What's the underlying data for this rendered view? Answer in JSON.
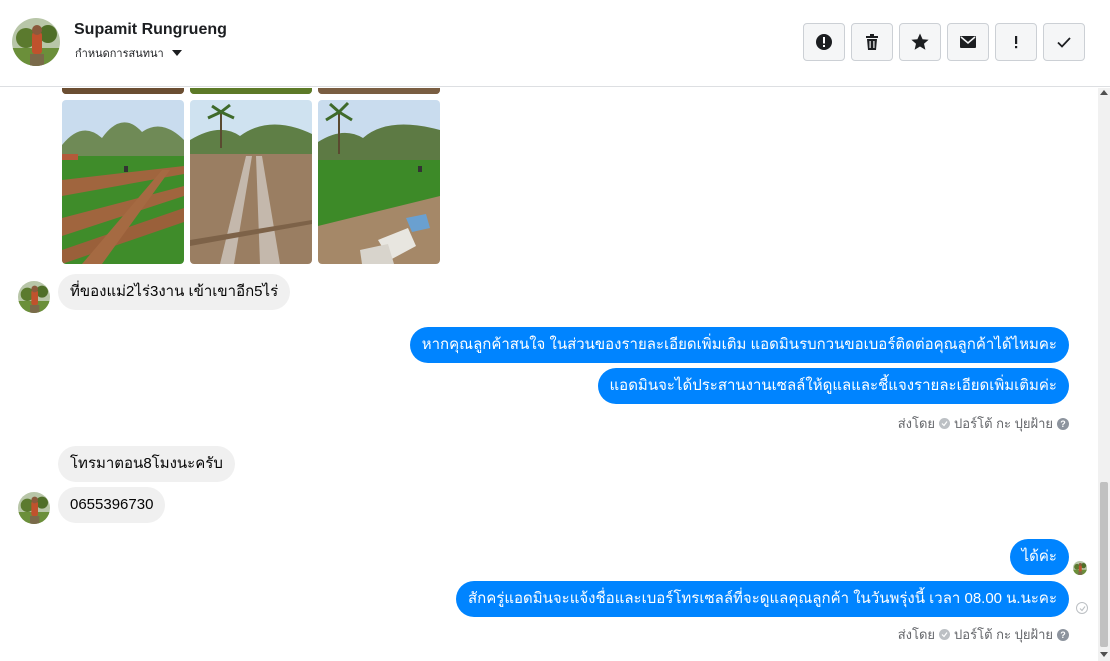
{
  "header": {
    "contact_name": "Supamit Rungrueng",
    "subtitle": "กำหนดการสนทนา",
    "toolbar": [
      {
        "icon": "alert-circle-icon",
        "name": "report-button"
      },
      {
        "icon": "trash-icon",
        "name": "delete-button"
      },
      {
        "icon": "star-icon",
        "name": "star-button"
      },
      {
        "icon": "envelope-icon",
        "name": "mark-unread-button"
      },
      {
        "icon": "exclamation-icon",
        "name": "spam-button"
      },
      {
        "icon": "checkmark-icon",
        "name": "done-button"
      }
    ]
  },
  "messages": {
    "in_1": "ที่ของแม่2ไร่3งาน เข้าเขาอีก5ไร่",
    "out_1": "หากคุณลูกค้าสนใจ ในส่วนของรายละเอียดเพิ่มเติม แอดมินรบกวนขอเบอร์ติดต่อคุณลูกค้าได้ไหมคะ",
    "out_2": "แอดมินจะได้ประสานงานเซลล์ให้ดูแลและชี้แจงรายละเอียดเพิ่มเติมค่ะ",
    "sent_by_1": "ส่งโดย",
    "sender_1": "ปอร์โต้ กะ ปุยฝ้าย",
    "in_2": "โทรมาตอน8โมงนะครับ",
    "in_3": "0655396730",
    "out_3": "ได้ค่ะ",
    "out_4": "สักครู่แอดมินจะแจ้งชื่อและเบอร์โทรเซลล์ที่จะดูแลคุณลูกค้า ในวันพรุ่งนี้ เวลา 08.00 น.นะคะ",
    "sent_by_2": "ส่งโดย",
    "sender_2": "ปอร์โต้ กะ ปุยฝ้าย"
  },
  "colors": {
    "outgoing_bubble": "#0084ff",
    "incoming_bubble": "#f0f0f0"
  }
}
